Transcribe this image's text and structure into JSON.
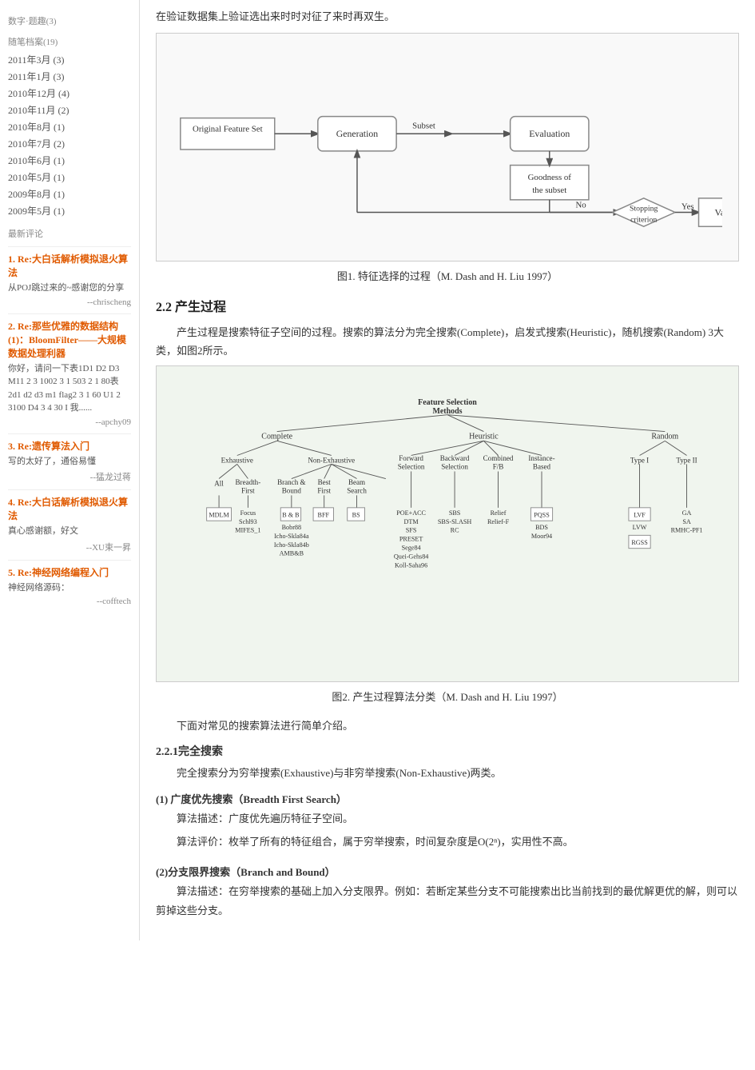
{
  "sidebar": {
    "category_title": "数字·题趣(3)",
    "archive_title": "随笔档案(19)",
    "archives": [
      "2011年3月 (3)",
      "2011年1月 (3)",
      "2010年12月 (4)",
      "2010年11月 (2)",
      "2010年8月 (1)",
      "2010年7月 (2)",
      "2010年6月 (1)",
      "2010年5月 (1)",
      "2009年8月 (1)",
      "2009年5月 (1)"
    ],
    "comments_title": "最新评论",
    "comments": [
      {
        "id": "1",
        "title": "1. Re:大白话解析模拟退火算法",
        "body": "从POJ跳过来的~感谢您的分享",
        "author": "--chrischeng"
      },
      {
        "id": "2",
        "title": "2. Re:那些优雅的数据结构(1)：BloomFilter——大规模数据处理利器",
        "body": "你好，请问一下表1D1 D2  D3  M11  2 3\n1002 3    1    503  2 1   80表2d1    d2\nd3    m1   flag2 3    1   60   U1   2   3100\nD4    3    4    30    I\n我......",
        "author": "--apchy09"
      },
      {
        "id": "3",
        "title": "3. Re:遗传算法入门",
        "body": "写的太好了，通俗易懂",
        "author": "--猛龙过蒋"
      },
      {
        "id": "4",
        "title": "4. Re:大白话解析模拟退火算法",
        "body": "真心感谢额，好文",
        "author": "--XU束一昇"
      },
      {
        "id": "5",
        "title": "5. Re:神经网络编程入门",
        "body": "神经网络源码：",
        "author": "--cofftech"
      }
    ]
  },
  "main": {
    "intro_text": "在验证数据集上验证选出来时时对征了来时再双生。",
    "fig1_caption": "图1. 特征选择的过程（M. Dash and H. Liu 1997）",
    "section22_title": "2.2 产生过程",
    "section22_body": "产生过程是搜索特征子空间的过程。搜索的算法分为完全搜索(Complete)，启发式搜索(Heuristic)，随机搜索(Random) 3大类，如图2所示。",
    "fig2_caption": "图2. 产生过程算法分类（M. Dash and H. Liu 1997）",
    "search_intro": "下面对常见的搜索算法进行简单介绍。",
    "section221_title": "2.2.1完全搜索",
    "section221_body": "完全搜索分为穷举搜索(Exhaustive)与非穷举搜索(Non-Exhaustive)两类。",
    "bfs_title": "(1) 广度优先搜索（Breadth First Search）",
    "bfs_desc": "算法描述：广度优先遍历特征子空间。",
    "bfs_eval": "算法评价：枚举了所有的特征组合，属于穷举搜索，时间复杂度是O(2ⁿ)，实用性不高。",
    "bb_title": "(2)分支限界搜索（Branch and Bound）",
    "bb_desc": "算法描述：在穷举搜索的基础上加入分支限界。例如：若断定某些分支不可能搜索出比当前找到的最优解更优的解，则可以剪掉这些分支。",
    "flowchart": {
      "original_feature_set": "Original Feature Set",
      "generation": "Generation",
      "subset": "Subset",
      "evaluation": "Evaluation",
      "goodness_of": "Goodness of",
      "the_subset": "the subset",
      "no": "No",
      "stopping_criterion": "Stopping\ncriterion",
      "yes": "Yes",
      "validation": "Validation"
    },
    "tree": {
      "root": "Feature Selection\nMethods",
      "l1_complete": "Complete",
      "l1_heuristic": "Heuristic",
      "l1_random": "Random",
      "l2_exhaustive": "Exhaustive",
      "l2_nonexhaustive": "Non-Exhaustive",
      "l2_forward": "Forward\nSelection",
      "l2_backward": "Backward\nSelection",
      "l2_combined": "Combined\nF/B",
      "l2_instance": "Instance-\nBased",
      "l2_type1": "Type I",
      "l2_type2": "Type II",
      "l3_all": "All",
      "l3_breadth": "Breadth-\nFirst",
      "l3_branch": "Branch &\nBound",
      "l3_best": "Best\nFirst",
      "l3_beam": "Beam\nSearch",
      "mdlm": "MDLM",
      "focus": "Focus",
      "schl93": "Schl93",
      "mifes1": "MIFES_1",
      "bb": "B & B",
      "bobr88": "Bobr88",
      "icho_skla84a": "Icho-Skla84a",
      "icho_skla84b": "Icho-Skla84b",
      "ambb": "AMB&B",
      "bff": "BFF",
      "bs": "BS",
      "poe_acc": "POE+ACC",
      "dtm": "DTM",
      "sfs": "SFS",
      "preset": "PRESET",
      "sege84": "Sege84",
      "quei_gehs84": "Quei-Gehs84",
      "koll_saha96": "Koll-Saha96",
      "sbs": "SBS",
      "sbs_slash": "SBS-Sl.ASH",
      "rc": "RC",
      "pqss": "PQSS",
      "bds": "BDS",
      "moor94": "Moor94",
      "relief": "Relief",
      "relief_f": "Relief-F",
      "lve": "LVF",
      "lvw": "LVW",
      "rgss": "RGSS",
      "ga": "GA",
      "sa": "SA",
      "rmhc_pf1": "RMHC-PF1"
    }
  }
}
